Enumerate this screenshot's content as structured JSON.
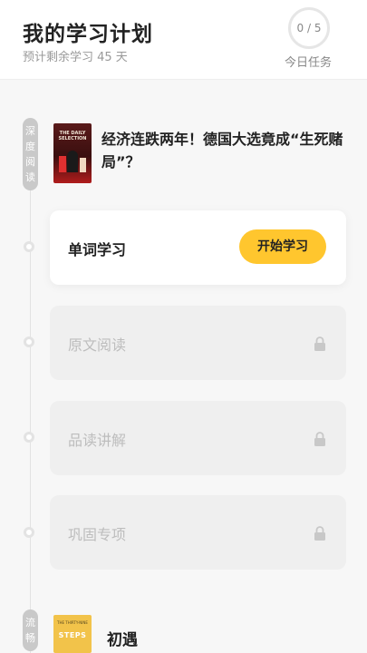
{
  "header": {
    "title": "我的学习计划",
    "subtitle": "预计剩余学习 45 天",
    "task_progress": "0 / 5",
    "task_label": "今日任务"
  },
  "sections": [
    {
      "tag_chars": [
        "深",
        "度",
        "阅",
        "读"
      ],
      "cover_text": "THE DAILY SELECTION",
      "article_title": "经济连跌两年！德国大选竟成“生死赌局”？",
      "steps": [
        {
          "label": "单词学习",
          "status": "active",
          "action": "开始学习"
        },
        {
          "label": "原文阅读",
          "status": "locked"
        },
        {
          "label": "品读讲解",
          "status": "locked"
        },
        {
          "label": "巩固专项",
          "status": "locked"
        }
      ]
    },
    {
      "tag_chars": [
        "流",
        "畅"
      ],
      "cover_text_top": "THE THIRTY-NINE",
      "cover_text_main": "STEPS",
      "article_title": "初遇"
    }
  ],
  "colors": {
    "accent": "#ffc62e",
    "locked_card": "#efefef",
    "tag": "#c9c9c9"
  },
  "icons": {
    "lock": "lock-icon",
    "progress": "progress-ring"
  }
}
